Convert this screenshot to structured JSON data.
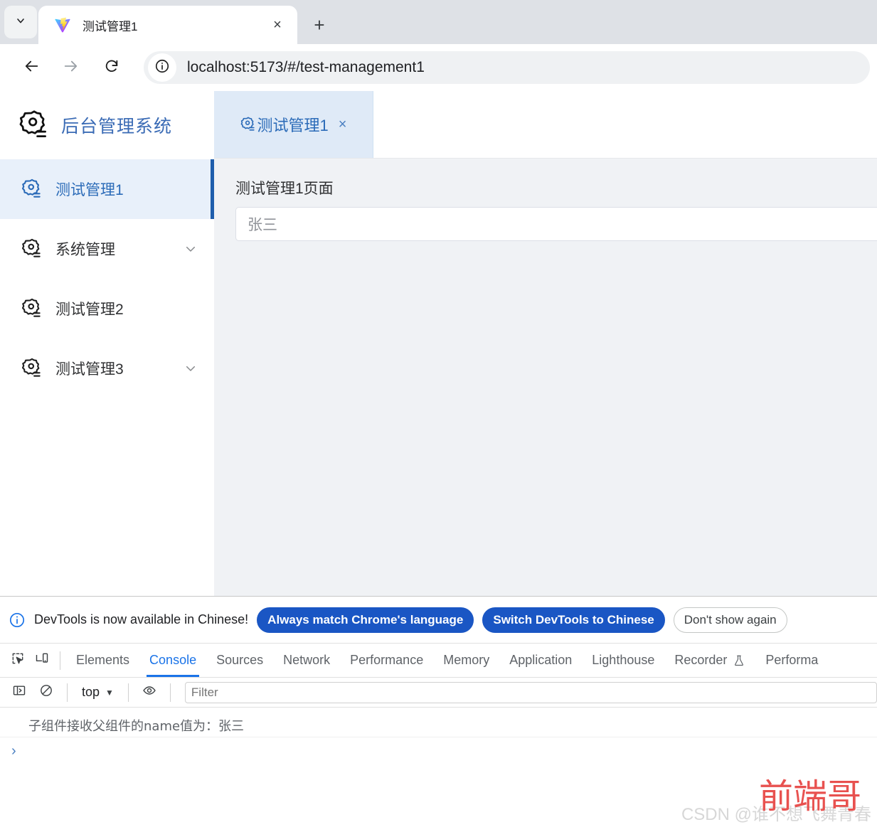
{
  "browser": {
    "tab_search_icon": "chevron-down-icon",
    "tab": {
      "favicon": "vite-logo-icon",
      "title": "测试管理1",
      "close_label": "×"
    },
    "new_tab_label": "+",
    "nav": {
      "back_icon": "arrow-left-icon",
      "forward_icon": "arrow-right-icon",
      "reload_icon": "reload-icon",
      "site_info_icon": "info-circle-icon"
    },
    "url": "localhost:5173/#/test-management1"
  },
  "app": {
    "logo_icon": "gear-setting-icon",
    "logo_text": "后台管理系统",
    "sidebar": {
      "items": [
        {
          "label": "测试管理1",
          "icon": "gear-setting-icon",
          "active": true,
          "expandable": false
        },
        {
          "label": "系统管理",
          "icon": "gear-setting-icon",
          "active": false,
          "expandable": true
        },
        {
          "label": "测试管理2",
          "icon": "gear-setting-icon",
          "active": false,
          "expandable": false
        },
        {
          "label": "测试管理3",
          "icon": "gear-setting-icon",
          "active": false,
          "expandable": true
        }
      ]
    },
    "page_tabs": [
      {
        "label": "测试管理1",
        "icon": "gear-setting-icon",
        "close_label": "×",
        "active": true
      }
    ],
    "content": {
      "title": "测试管理1页面",
      "input_value": "张三",
      "input_placeholder": "张三"
    }
  },
  "devtools": {
    "banner": {
      "icon": "info-circle-icon",
      "message": "DevTools is now available in Chinese!",
      "buttons": [
        {
          "label": "Always match Chrome's language",
          "style": "primary"
        },
        {
          "label": "Switch DevTools to Chinese",
          "style": "primary"
        },
        {
          "label": "Don't show again",
          "style": "ghost"
        }
      ]
    },
    "left_icons": [
      {
        "name": "inspect-element-icon"
      },
      {
        "name": "device-toolbar-icon"
      }
    ],
    "tabs": [
      {
        "label": "Elements",
        "active": false
      },
      {
        "label": "Console",
        "active": true
      },
      {
        "label": "Sources",
        "active": false
      },
      {
        "label": "Network",
        "active": false
      },
      {
        "label": "Performance",
        "active": false
      },
      {
        "label": "Memory",
        "active": false
      },
      {
        "label": "Application",
        "active": false
      },
      {
        "label": "Lighthouse",
        "active": false
      },
      {
        "label": "Recorder",
        "active": false,
        "icon": "flask-icon"
      },
      {
        "label": "Performa",
        "active": false
      }
    ],
    "console_toolbar": {
      "sidebar_toggle_icon": "console-sidebar-icon",
      "clear_icon": "clear-console-icon",
      "context": "top",
      "context_caret": "▼",
      "eye_icon": "eye-icon",
      "filter_placeholder": "Filter"
    },
    "log": {
      "messages": [
        "子组件接收父组件的name值为：张三"
      ],
      "prompt": "›"
    }
  },
  "watermark": {
    "csdn": "CSDN @谁不想飞舞青春",
    "red": "前端哥"
  },
  "colors": {
    "accent_blue": "#2b6bb8",
    "devtools_blue": "#1a73e8",
    "button_blue": "#1a56c4",
    "page_bg": "#f0f2f5",
    "active_menu_bg": "#e8f0fa",
    "watermark_red": "#e8514f"
  }
}
